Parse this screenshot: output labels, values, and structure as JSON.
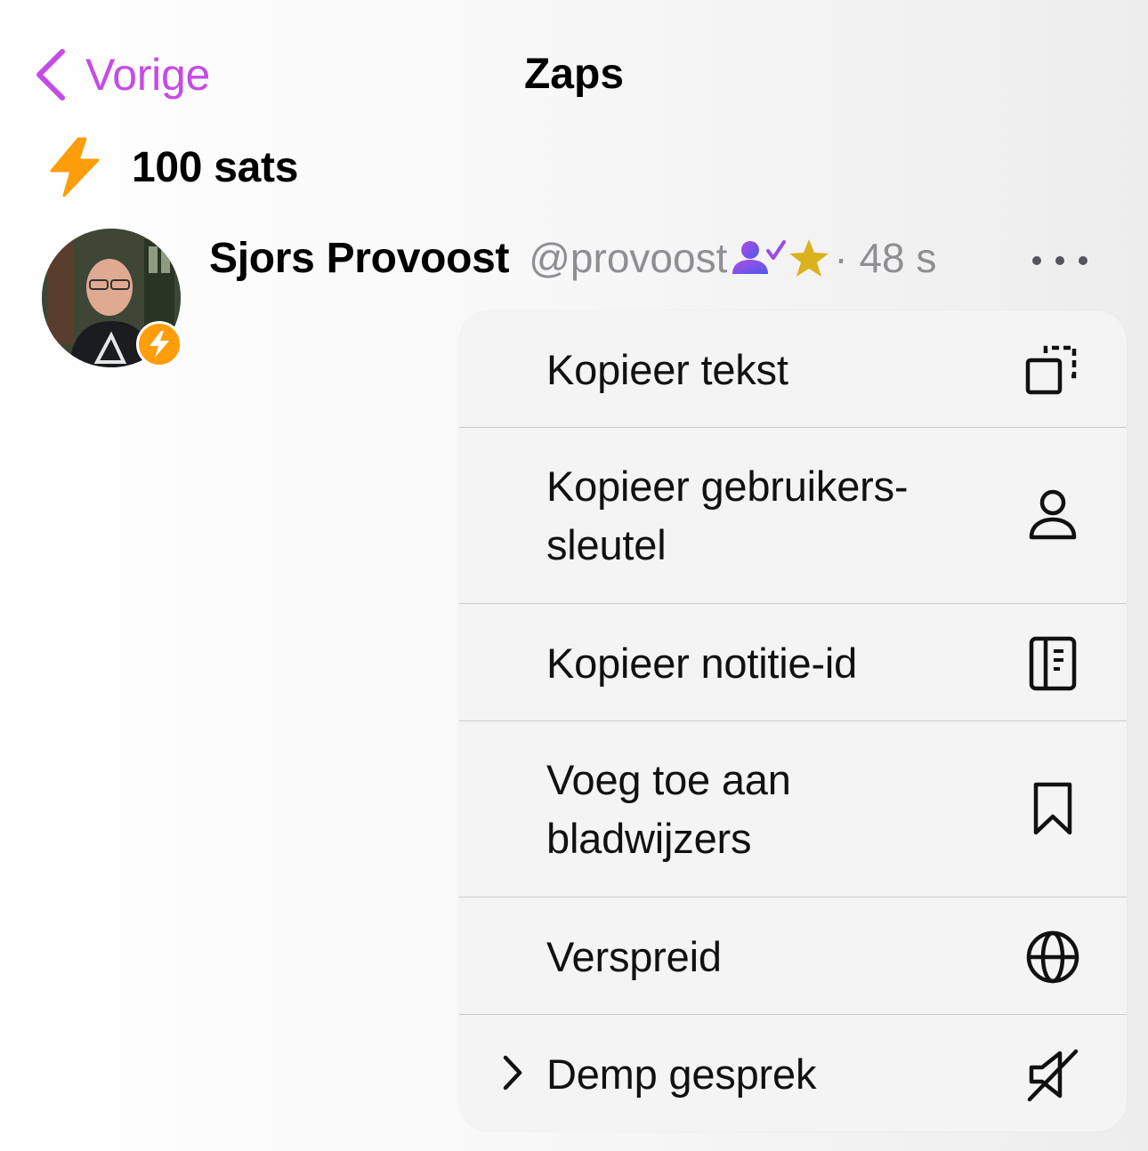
{
  "nav": {
    "back_label": "Vorige",
    "title": "Zaps"
  },
  "zap": {
    "amount_label": "100 sats"
  },
  "post": {
    "author_name": "Sjors Provoost",
    "author_handle": "@provoost",
    "time_label": "· 48 s"
  },
  "menu": {
    "items": [
      {
        "label_line1": "Kopieer tekst",
        "label_line2": "",
        "icon": "copy-icon"
      },
      {
        "label_line1": "Kopieer gebruikers-",
        "label_line2": "sleutel",
        "icon": "person-icon"
      },
      {
        "label_line1": "Kopieer notitie-id",
        "label_line2": "",
        "icon": "note-id-icon"
      },
      {
        "label_line1": "Voeg toe aan",
        "label_line2": "bladwijzers",
        "icon": "bookmark-icon"
      },
      {
        "label_line1": "Verspreid",
        "label_line2": "",
        "icon": "globe-icon"
      },
      {
        "label_line1": "Demp gesprek",
        "label_line2": "",
        "icon": "mute-icon"
      }
    ]
  },
  "colors": {
    "accent": "#c54be6",
    "zap": "#ff9d0a",
    "secondary_text": "#8e8e93",
    "verified": "#7b4be6",
    "star": "#d9b21c"
  }
}
